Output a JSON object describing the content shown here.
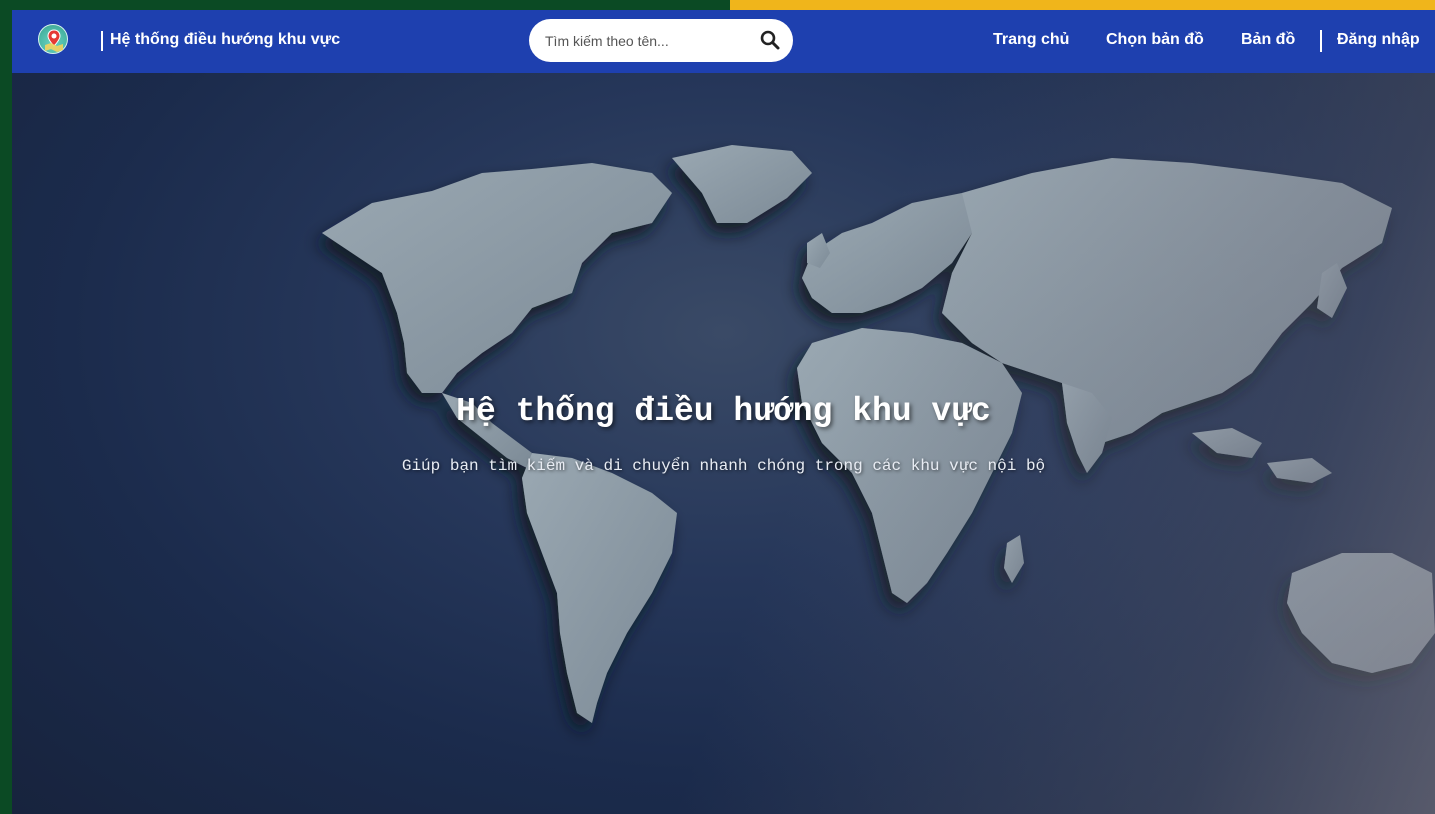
{
  "header": {
    "brand_title": "Hệ thống điều hướng khu vực",
    "logo_icon": "map-pin-icon"
  },
  "search": {
    "placeholder": "Tìm kiếm theo tên...",
    "icon": "search-icon"
  },
  "nav": {
    "home": "Trang chủ",
    "choose_map": "Chọn bản đồ",
    "map": "Bản đồ",
    "login": "Đăng nhập"
  },
  "hero": {
    "title": "Hệ thống điều hướng khu vực",
    "subtitle": "Giúp bạn tìm kiếm và di chuyển nhanh chóng trong các khu vực nội bộ"
  },
  "colors": {
    "navbar": "#1e40af",
    "accent_bar": "#f0b51b",
    "frame": "#0b4a24",
    "continents": "#8e9ba6"
  }
}
